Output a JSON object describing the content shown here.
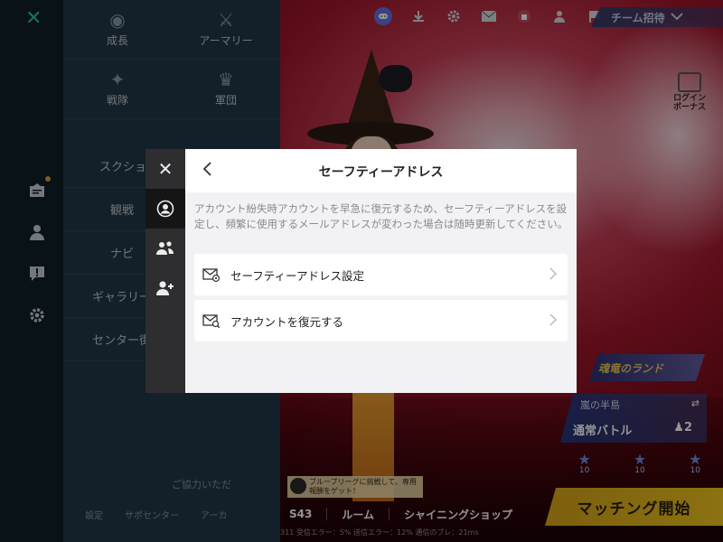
{
  "game": {
    "team_invite_label": "チーム招待",
    "login_bonus_label": "ログインボーナス",
    "map_name": "魂竜のランド",
    "mode_sub": "嵐の半島",
    "mode_main": "通常バトル",
    "party_count": "2",
    "slot_level": "10",
    "match_button": "マッチング開始",
    "league_note": "ブループリーグに挑戦して、専用報酬をゲット！",
    "bottom_bar": {
      "season": "S43",
      "room": "ルーム",
      "shop": "シャイニングショップ"
    },
    "status_line": "311 受信エラー：5% 送信エラー：12% 通信のブレ：21ms"
  },
  "menu": {
    "grid": [
      {
        "label": "成長",
        "icon": "medal-icon"
      },
      {
        "label": "アーマリー",
        "icon": "weapon-icon"
      },
      {
        "label": "戦隊",
        "icon": "squad-icon"
      },
      {
        "label": "軍団",
        "icon": "legion-icon"
      }
    ],
    "list": [
      "スクショ",
      "観戦",
      "ナビ",
      "ギャラリー",
      "センター街"
    ],
    "mid_text": "ご協力いただ",
    "bottom_items": [
      "設定",
      "サポセンター",
      "アーカ"
    ]
  },
  "dialog": {
    "title": "セーフティーアドレス",
    "description": "アカウント紛失時アカウントを早急に復元するため、セーフティーアドレスを設定し、頻繁に使用するメールアドレスが変わった場合は随時更新してください。",
    "options": [
      {
        "label": "セーフティーアドレス設定",
        "icon": "mail-settings-icon"
      },
      {
        "label": "アカウントを復元する",
        "icon": "mail-search-icon"
      }
    ]
  },
  "colors": {
    "accent_teal": "#2fbf9f",
    "match_yellow": "#f0c520",
    "dialog_bg": "#f2f2f4",
    "side_tab_bg": "#2e2e30"
  }
}
